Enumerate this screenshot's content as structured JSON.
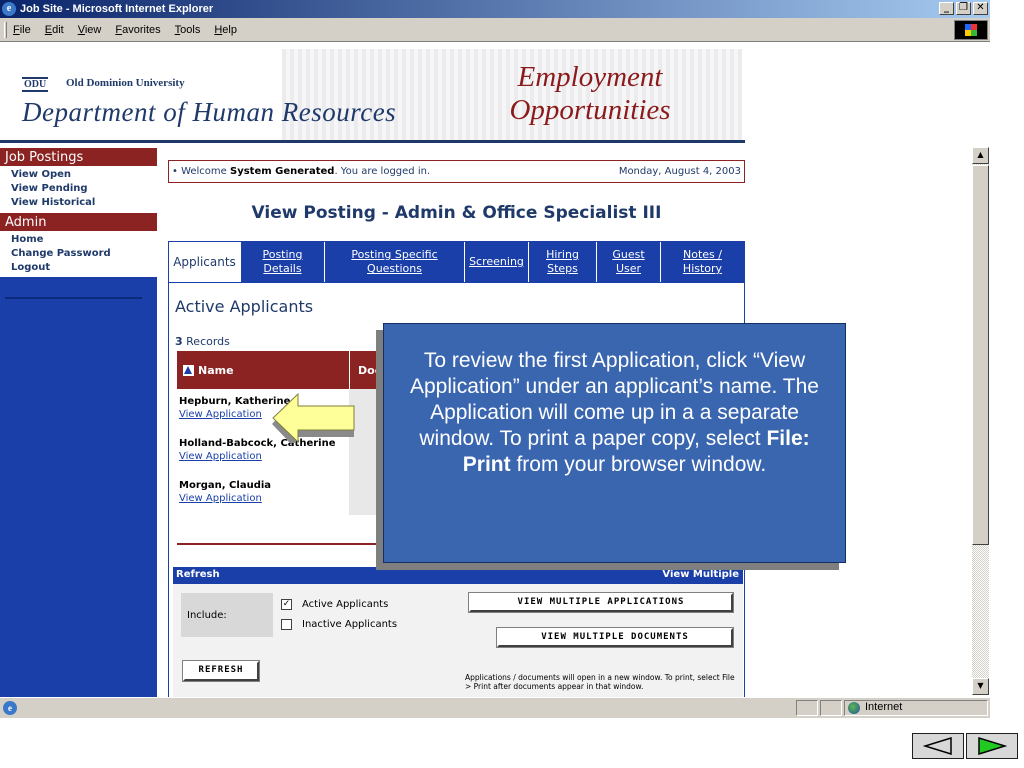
{
  "window": {
    "title": "Job Site - Microsoft Internet Explorer",
    "title_buttons": [
      "_",
      "у",
      "×"
    ]
  },
  "menubar": {
    "items": [
      "File",
      "Edit",
      "View",
      "Favorites",
      "Tools",
      "Help"
    ]
  },
  "banner": {
    "logo_text": "ODU",
    "university": "Old Dominion University",
    "department": "Department of Human Resources",
    "employment_line1": "Employment",
    "employment_line2": "Opportunities"
  },
  "sidebar": {
    "job_postings_heading": "Job Postings",
    "job_links": [
      "View Open",
      "View Pending",
      "View Historical"
    ],
    "admin_heading": "Admin",
    "admin_links": [
      "Home",
      "Change Password",
      "Logout"
    ]
  },
  "welcome": {
    "prefix": "• Welcome ",
    "user": "System Generated",
    "suffix": ". You are logged in.",
    "date": "Monday, August 4, 2003"
  },
  "page_title": "View Posting - Admin & Office Specialist III",
  "tabs": [
    {
      "line1": "Applicants",
      "line2": ""
    },
    {
      "line1": "Posting",
      "line2": "Details"
    },
    {
      "line1": "Posting Specific",
      "line2": "Questions"
    },
    {
      "line1": "Screening",
      "line2": ""
    },
    {
      "line1": "Hiring",
      "line2": "Steps"
    },
    {
      "line1": "Guest",
      "line2": "User"
    },
    {
      "line1": "Notes /",
      "line2": "History"
    }
  ],
  "applicants": {
    "heading": "Active Applicants",
    "record_count": "3",
    "record_label": " Records",
    "col_name": "Name",
    "col_doc": "Doc",
    "rows": [
      {
        "name": "Hepburn, Katherine",
        "link": "View Application"
      },
      {
        "name": "Holland-Babcock, Catherine",
        "link": "View Application"
      },
      {
        "name": "Morgan, Claudia",
        "link": "View Application"
      }
    ]
  },
  "refresh_panel": {
    "bar_label": "Refresh",
    "include_label": "Include:",
    "active_label": "Active Applicants",
    "inactive_label": "Inactive Applicants",
    "refresh_button": "REFRESH",
    "checkmark": "✓"
  },
  "multi_panel": {
    "bar_label": "View Multiple",
    "apps_button": "VIEW MULTIPLE APPLICATIONS",
    "docs_button": "VIEW MULTIPLE DOCUMENTS",
    "note": "Applications / documents will open in a new window. To print, select File > Print after documents appear in that window."
  },
  "callout": {
    "text_before": "To review the first Application, click “View Application” under an applicant’s name. The Application will come up in a a separate window.  To print a paper copy, select ",
    "text_bold": "File: Print",
    "text_after": " from your browser window."
  },
  "statusbar": {
    "zone": "Internet"
  },
  "scrollbar": {
    "up_arrow": "▲",
    "down_arrow": "▼"
  },
  "colors": {
    "navy": "#1a3fa8",
    "maroon": "#8b2323",
    "callout_blue": "#3a66b0",
    "arrow_yellow": "#ffff99"
  }
}
